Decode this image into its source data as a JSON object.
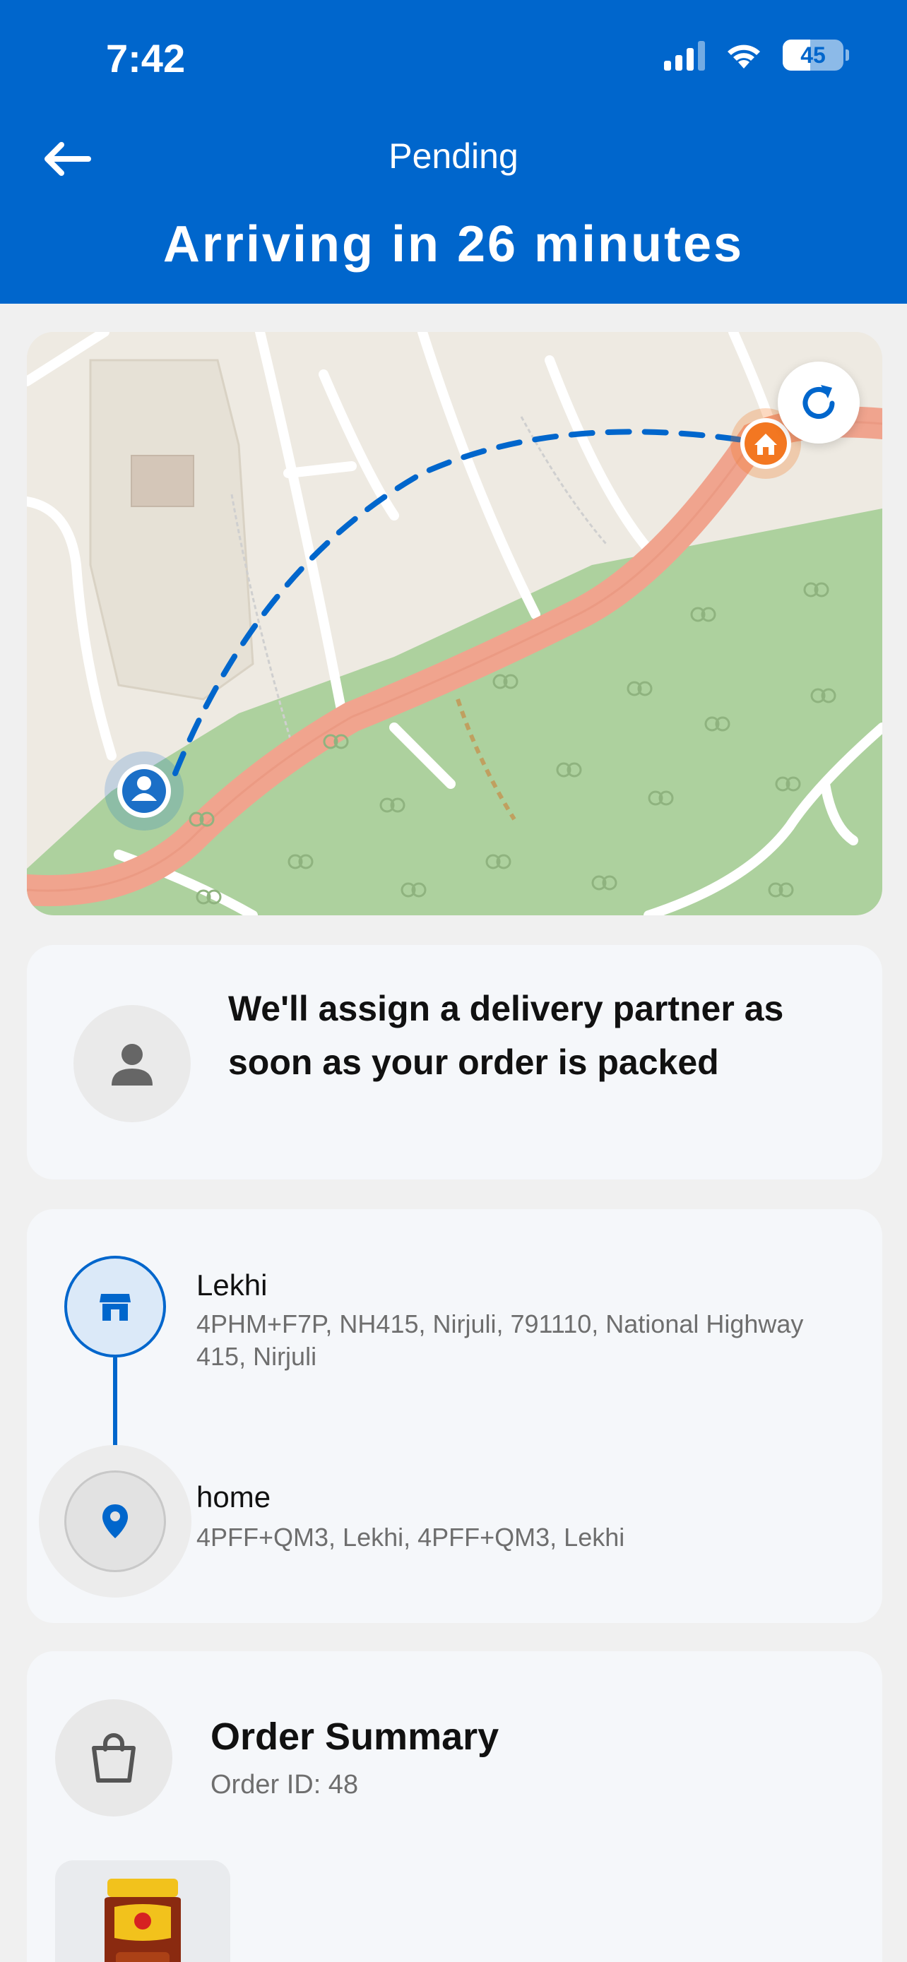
{
  "status_bar": {
    "time": "7:42",
    "battery": "45"
  },
  "header": {
    "status": "Pending",
    "title": "Arriving in 26 minutes"
  },
  "map": {
    "refresh_icon": "refresh-icon",
    "colors": {
      "route_dash": "#0066cc",
      "road_major": "#f0a48e",
      "park": "#add19e",
      "store_pin": "#f37721"
    }
  },
  "partner": {
    "message": "We'll assign a delivery partner as soon as your order is packed"
  },
  "route": {
    "from": {
      "name": "Lekhi",
      "address": "4PHM+F7P, NH415, Nirjuli, 791110, National Highway 415, Nirjuli"
    },
    "to": {
      "name": "home",
      "address": "4PFF+QM3, Lekhi, 4PFF+QM3, Lekhi"
    }
  },
  "order": {
    "title": "Order Summary",
    "id_label": "Order ID: 48"
  }
}
